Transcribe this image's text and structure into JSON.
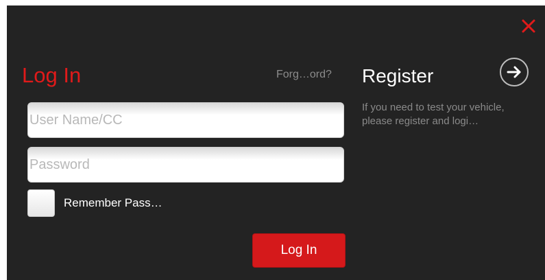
{
  "login": {
    "title": "Log In",
    "forgot_label": "Forg…ord?",
    "username_placeholder": "User Name/CC",
    "username_value": "",
    "password_placeholder": "Password",
    "password_value": "",
    "remember_label": "Remember Pass…",
    "remember_checked": false,
    "submit_label": "Log In"
  },
  "register": {
    "title": "Register",
    "description": "If you need to test your vehicle,\n please register and logi…"
  },
  "icons": {
    "close": "close-icon",
    "register_arrow": "arrow-right-circle-icon"
  },
  "colors": {
    "background": "#232323",
    "accent_red": "#e01a1a",
    "button_red": "#d5191b",
    "muted_text": "#8c8c8c"
  }
}
